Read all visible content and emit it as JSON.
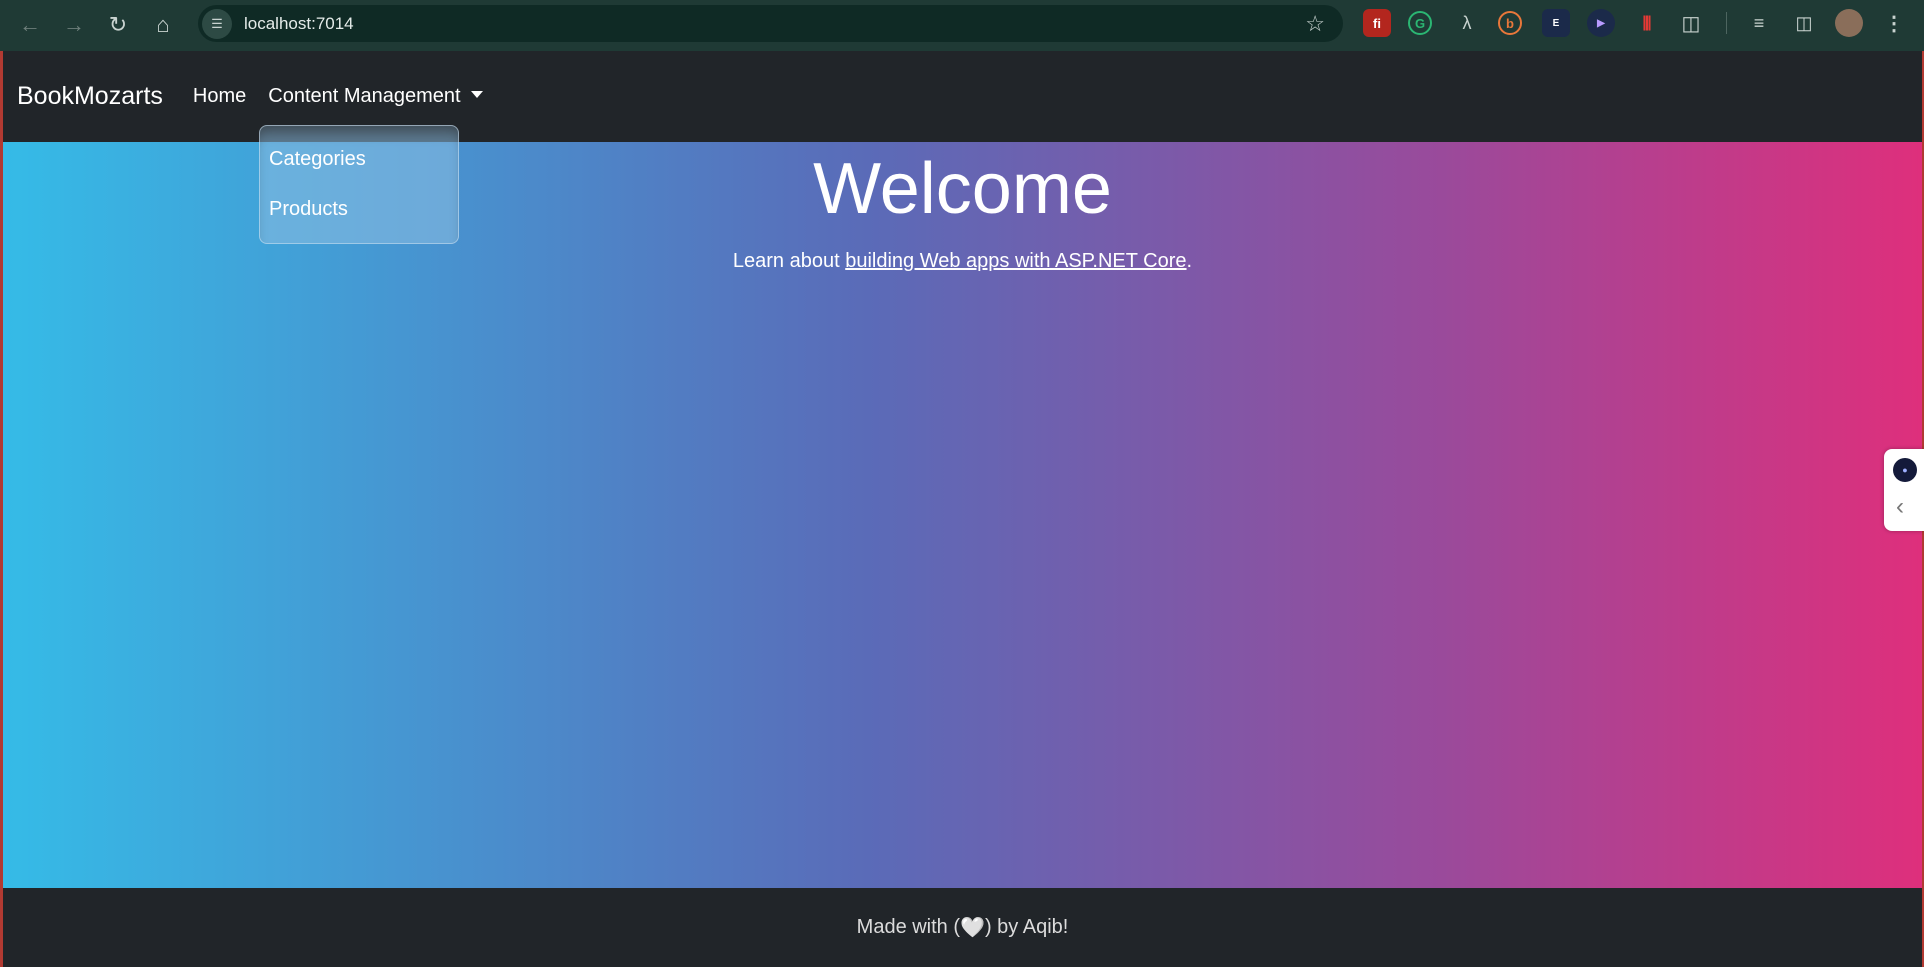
{
  "browser": {
    "url": "localhost:7014",
    "icons": {
      "back": "arrow-left-icon",
      "forward": "arrow-right-icon",
      "reload": "reload-icon",
      "home": "home-icon",
      "site_info": "tune-icon",
      "bookmark": "star-icon"
    },
    "extensions": [
      {
        "name": "fi-extension",
        "glyph": "fi",
        "bg": "#b3261e"
      },
      {
        "name": "grammarly-extension",
        "glyph": "G",
        "bg": "#1e8c5a"
      },
      {
        "name": "signature-extension",
        "glyph": "A",
        "bg": "transparent"
      },
      {
        "name": "b-extension",
        "glyph": "b",
        "bg": "transparent"
      },
      {
        "name": "e-extension",
        "glyph": "E",
        "bg": "#1b2a4a"
      },
      {
        "name": "media-extension",
        "glyph": "▶",
        "bg": "#1b2a4a"
      },
      {
        "name": "audio-extension",
        "glyph": "|||",
        "bg": "transparent"
      },
      {
        "name": "puzzle-extension",
        "glyph": "⧉",
        "bg": "transparent"
      }
    ]
  },
  "navbar": {
    "brand": "BookMozarts",
    "home": "Home",
    "content_management": "Content Management"
  },
  "dropdown": {
    "items": [
      "Categories",
      "Products"
    ]
  },
  "hero": {
    "title": "Welcome",
    "lead_prefix": "Learn about ",
    "lead_link": "building Web apps with ASP.NET Core",
    "lead_suffix": "."
  },
  "footer": {
    "prefix": "Made with (",
    "heart": "🤍",
    "suffix": ") by Aqib!"
  },
  "colors": {
    "navbar_bg": "#212529",
    "gradient_start": "#35bbe7",
    "gradient_end": "#de2f7c"
  }
}
